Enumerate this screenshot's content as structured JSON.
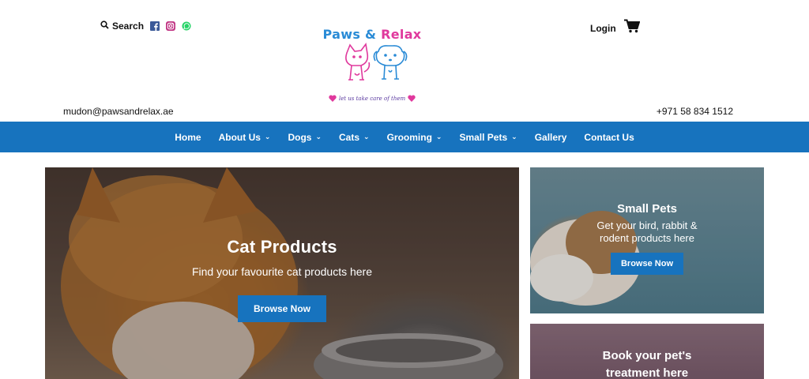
{
  "header": {
    "search_label": "Search",
    "login_label": "Login",
    "logo": {
      "title_part1": "Paws",
      "title_amp": " & ",
      "title_part2": "Relax",
      "tagline": "let us take care of them"
    },
    "email": "mudon@pawsandrelax.ae",
    "phone": "+971 58 834 1512"
  },
  "nav": {
    "items": [
      {
        "label": "Home",
        "dropdown": false
      },
      {
        "label": "About Us",
        "dropdown": true
      },
      {
        "label": "Dogs",
        "dropdown": true
      },
      {
        "label": "Cats",
        "dropdown": true
      },
      {
        "label": "Grooming",
        "dropdown": true
      },
      {
        "label": "Small Pets",
        "dropdown": true
      },
      {
        "label": "Gallery",
        "dropdown": false
      },
      {
        "label": "Contact Us",
        "dropdown": false
      }
    ],
    "caret": "⌄"
  },
  "hero": {
    "title": "Cat Products",
    "subtitle": "Find your favourite cat products here",
    "button": "Browse Now"
  },
  "cards": {
    "small_pets": {
      "title": "Small Pets",
      "subtitle_line1": "Get your bird, rabbit &",
      "subtitle_line2": "rodent products here",
      "button": "Browse Now"
    },
    "book": {
      "title_line1": "Book your pet's",
      "title_line2": "treatment here"
    }
  },
  "colors": {
    "brand_blue": "#1773be",
    "logo_blue": "#2a8bd6",
    "logo_pink": "#e0399d"
  },
  "icons": [
    "search-icon",
    "facebook-icon",
    "instagram-icon",
    "whatsapp-icon",
    "cart-icon"
  ]
}
